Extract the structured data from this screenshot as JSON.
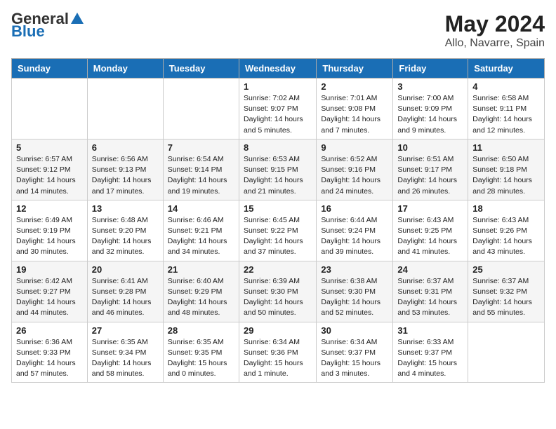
{
  "header": {
    "logo_general": "General",
    "logo_blue": "Blue",
    "month_year": "May 2024",
    "location": "Allo, Navarre, Spain"
  },
  "weekdays": [
    "Sunday",
    "Monday",
    "Tuesday",
    "Wednesday",
    "Thursday",
    "Friday",
    "Saturday"
  ],
  "weeks": [
    [
      {
        "day": "",
        "info": ""
      },
      {
        "day": "",
        "info": ""
      },
      {
        "day": "",
        "info": ""
      },
      {
        "day": "1",
        "info": "Sunrise: 7:02 AM\nSunset: 9:07 PM\nDaylight: 14 hours\nand 5 minutes."
      },
      {
        "day": "2",
        "info": "Sunrise: 7:01 AM\nSunset: 9:08 PM\nDaylight: 14 hours\nand 7 minutes."
      },
      {
        "day": "3",
        "info": "Sunrise: 7:00 AM\nSunset: 9:09 PM\nDaylight: 14 hours\nand 9 minutes."
      },
      {
        "day": "4",
        "info": "Sunrise: 6:58 AM\nSunset: 9:11 PM\nDaylight: 14 hours\nand 12 minutes."
      }
    ],
    [
      {
        "day": "5",
        "info": "Sunrise: 6:57 AM\nSunset: 9:12 PM\nDaylight: 14 hours\nand 14 minutes."
      },
      {
        "day": "6",
        "info": "Sunrise: 6:56 AM\nSunset: 9:13 PM\nDaylight: 14 hours\nand 17 minutes."
      },
      {
        "day": "7",
        "info": "Sunrise: 6:54 AM\nSunset: 9:14 PM\nDaylight: 14 hours\nand 19 minutes."
      },
      {
        "day": "8",
        "info": "Sunrise: 6:53 AM\nSunset: 9:15 PM\nDaylight: 14 hours\nand 21 minutes."
      },
      {
        "day": "9",
        "info": "Sunrise: 6:52 AM\nSunset: 9:16 PM\nDaylight: 14 hours\nand 24 minutes."
      },
      {
        "day": "10",
        "info": "Sunrise: 6:51 AM\nSunset: 9:17 PM\nDaylight: 14 hours\nand 26 minutes."
      },
      {
        "day": "11",
        "info": "Sunrise: 6:50 AM\nSunset: 9:18 PM\nDaylight: 14 hours\nand 28 minutes."
      }
    ],
    [
      {
        "day": "12",
        "info": "Sunrise: 6:49 AM\nSunset: 9:19 PM\nDaylight: 14 hours\nand 30 minutes."
      },
      {
        "day": "13",
        "info": "Sunrise: 6:48 AM\nSunset: 9:20 PM\nDaylight: 14 hours\nand 32 minutes."
      },
      {
        "day": "14",
        "info": "Sunrise: 6:46 AM\nSunset: 9:21 PM\nDaylight: 14 hours\nand 34 minutes."
      },
      {
        "day": "15",
        "info": "Sunrise: 6:45 AM\nSunset: 9:22 PM\nDaylight: 14 hours\nand 37 minutes."
      },
      {
        "day": "16",
        "info": "Sunrise: 6:44 AM\nSunset: 9:24 PM\nDaylight: 14 hours\nand 39 minutes."
      },
      {
        "day": "17",
        "info": "Sunrise: 6:43 AM\nSunset: 9:25 PM\nDaylight: 14 hours\nand 41 minutes."
      },
      {
        "day": "18",
        "info": "Sunrise: 6:43 AM\nSunset: 9:26 PM\nDaylight: 14 hours\nand 43 minutes."
      }
    ],
    [
      {
        "day": "19",
        "info": "Sunrise: 6:42 AM\nSunset: 9:27 PM\nDaylight: 14 hours\nand 44 minutes."
      },
      {
        "day": "20",
        "info": "Sunrise: 6:41 AM\nSunset: 9:28 PM\nDaylight: 14 hours\nand 46 minutes."
      },
      {
        "day": "21",
        "info": "Sunrise: 6:40 AM\nSunset: 9:29 PM\nDaylight: 14 hours\nand 48 minutes."
      },
      {
        "day": "22",
        "info": "Sunrise: 6:39 AM\nSunset: 9:30 PM\nDaylight: 14 hours\nand 50 minutes."
      },
      {
        "day": "23",
        "info": "Sunrise: 6:38 AM\nSunset: 9:30 PM\nDaylight: 14 hours\nand 52 minutes."
      },
      {
        "day": "24",
        "info": "Sunrise: 6:37 AM\nSunset: 9:31 PM\nDaylight: 14 hours\nand 53 minutes."
      },
      {
        "day": "25",
        "info": "Sunrise: 6:37 AM\nSunset: 9:32 PM\nDaylight: 14 hours\nand 55 minutes."
      }
    ],
    [
      {
        "day": "26",
        "info": "Sunrise: 6:36 AM\nSunset: 9:33 PM\nDaylight: 14 hours\nand 57 minutes."
      },
      {
        "day": "27",
        "info": "Sunrise: 6:35 AM\nSunset: 9:34 PM\nDaylight: 14 hours\nand 58 minutes."
      },
      {
        "day": "28",
        "info": "Sunrise: 6:35 AM\nSunset: 9:35 PM\nDaylight: 15 hours\nand 0 minutes."
      },
      {
        "day": "29",
        "info": "Sunrise: 6:34 AM\nSunset: 9:36 PM\nDaylight: 15 hours\nand 1 minute."
      },
      {
        "day": "30",
        "info": "Sunrise: 6:34 AM\nSunset: 9:37 PM\nDaylight: 15 hours\nand 3 minutes."
      },
      {
        "day": "31",
        "info": "Sunrise: 6:33 AM\nSunset: 9:37 PM\nDaylight: 15 hours\nand 4 minutes."
      },
      {
        "day": "",
        "info": ""
      }
    ]
  ]
}
